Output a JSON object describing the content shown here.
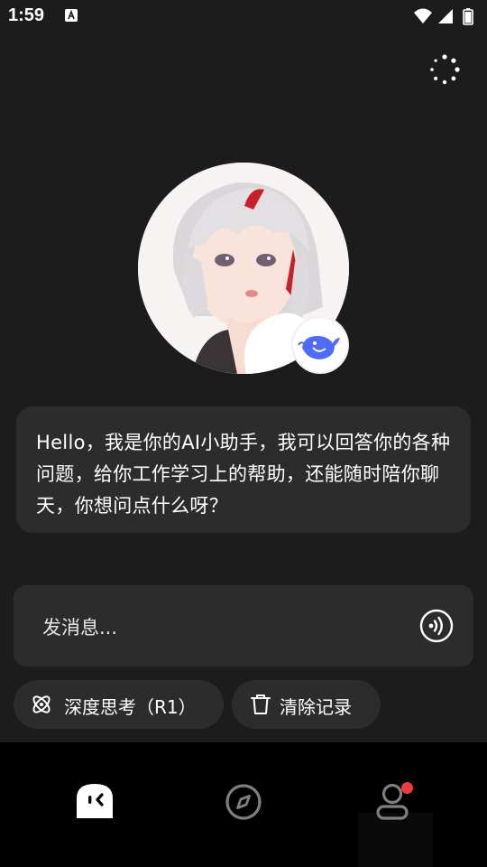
{
  "status_bar": {
    "time": "1:59"
  },
  "chat": {
    "greeting": "Hello，我是你的AI小助手，我可以回答你的各种问题，给你工作学习上的帮助，还能随时陪你聊天，你想问点什么呀？"
  },
  "input": {
    "placeholder": "发消息..."
  },
  "actions": {
    "deep_think_label": "深度思考（R1）",
    "clear_label": "清除记录"
  },
  "bottom_nav": {
    "items": [
      "chat-icon",
      "compass-icon",
      "user-icon"
    ],
    "profile_has_notification": true
  },
  "colors": {
    "background": "#1c1c1c",
    "card": "#2c2c2c",
    "nav_background": "#000000",
    "notification_dot": "#ee3b3b",
    "badge_whale": "#4d6bfe"
  }
}
